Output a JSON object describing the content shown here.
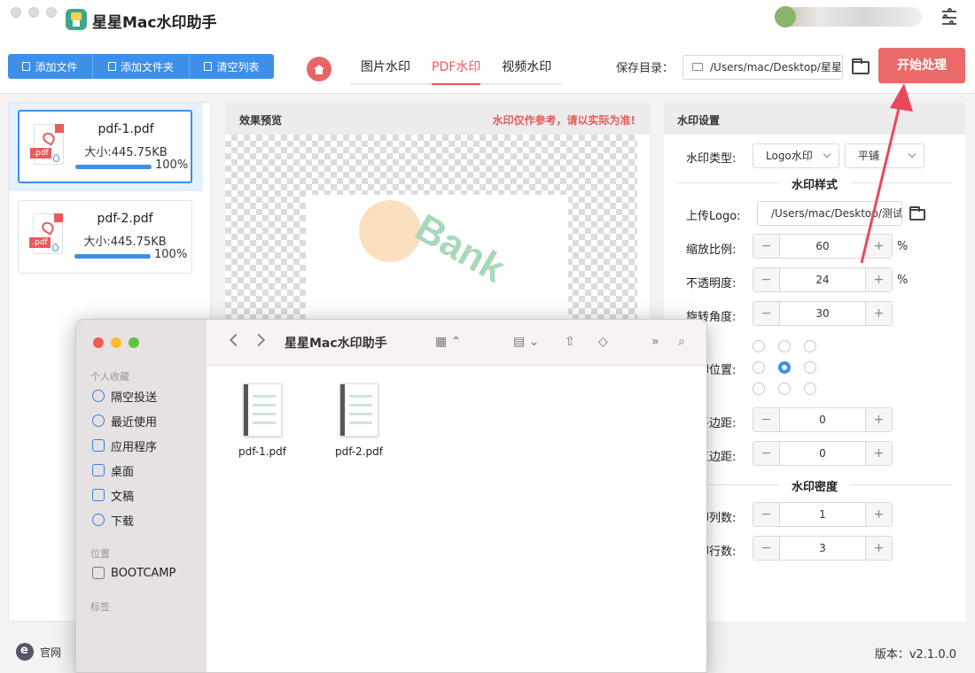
{
  "app": {
    "title": "星星Mac水印助手"
  },
  "toolbar": {
    "add_file": "添加文件",
    "add_folder": "添加文件夹",
    "clear_list": "清空列表",
    "tabs": [
      "图片水印",
      "PDF水印",
      "视频水印"
    ],
    "active_tab": "PDF水印",
    "save_label": "保存目录：",
    "save_path": "/Users/mac/Desktop/星星",
    "start_button": "开始处理"
  },
  "files": [
    {
      "name": "pdf-1.pdf",
      "size": "大小:445.75KB",
      "progress_text": "100%",
      "progress": 1.0
    },
    {
      "name": "pdf-2.pdf",
      "size": "大小:445.75KB",
      "progress_text": "100%",
      "progress": 1.0
    }
  ],
  "preview": {
    "title": "效果预览",
    "notice": "水印仅作参考，请以实际为准!",
    "watermark_text": "Bank"
  },
  "settings": {
    "title": "水印设置",
    "type_label": "水印类型:",
    "type_value": "Logo水印",
    "layout_value": "平铺",
    "style_section": "水印样式",
    "logo_label": "上传Logo:",
    "logo_path": "/Users/mac/Desktop/测试",
    "scale_label": "缩放比例:",
    "scale_value": "60",
    "scale_unit": "%",
    "opacity_label": "不透明度:",
    "opacity_value": "24",
    "opacity_unit": "%",
    "rotation_label": "旋转角度:",
    "rotation_value": "30",
    "position_label": "印位置:",
    "hmargin_label": "平边距:",
    "hmargin_value": "0",
    "vmargin_label": "直边距:",
    "vmargin_value": "0",
    "density_section": "水印密度",
    "cols_label": "印列数:",
    "cols_value": "1",
    "rows_label": "印行数:",
    "rows_value": "3",
    "minus": "−",
    "plus": "+"
  },
  "footer": {
    "website": "官网",
    "version": "版本：v2.1.0.0"
  },
  "finder": {
    "title": "星星Mac水印助手",
    "favorites_label": "个人收藏",
    "favorites": [
      "隔空投送",
      "最近使用",
      "应用程序",
      "桌面",
      "文稿",
      "下载"
    ],
    "locations_label": "位置",
    "locations": [
      "BOOTCAMP"
    ],
    "tags_label": "标签",
    "files": [
      "pdf-1.pdf",
      "pdf-2.pdf"
    ]
  },
  "colors": {
    "accent": "#3d8fe8",
    "brand_red": "#ea6a6a"
  }
}
